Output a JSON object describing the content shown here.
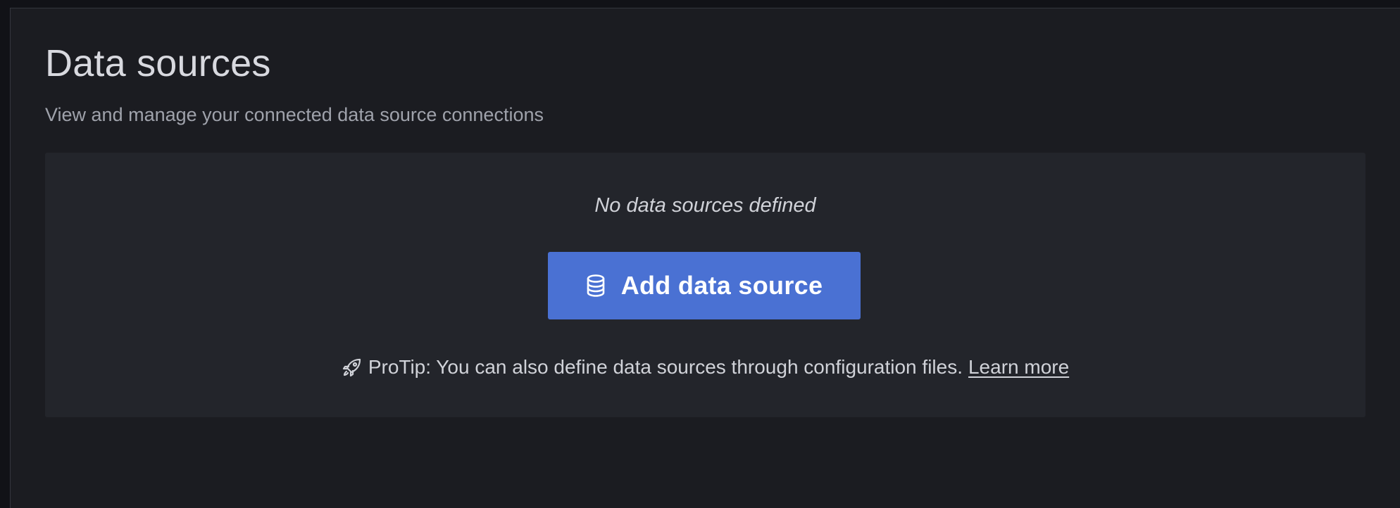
{
  "header": {
    "title": "Data sources",
    "subtitle": "View and manage your connected data source connections"
  },
  "empty_state": {
    "message": "No data sources defined",
    "button": {
      "label": "Add data source",
      "icon": "database-icon"
    },
    "protip": {
      "icon": "rocket-icon",
      "text": "ProTip: You can also define data sources through configuration files.",
      "link_label": "Learn more"
    }
  },
  "colors": {
    "background": "#1b1c21",
    "panel": "#23252b",
    "primary_button": "#4a71d3",
    "text_primary": "#d8d9df",
    "text_secondary": "#9fa2ab"
  }
}
